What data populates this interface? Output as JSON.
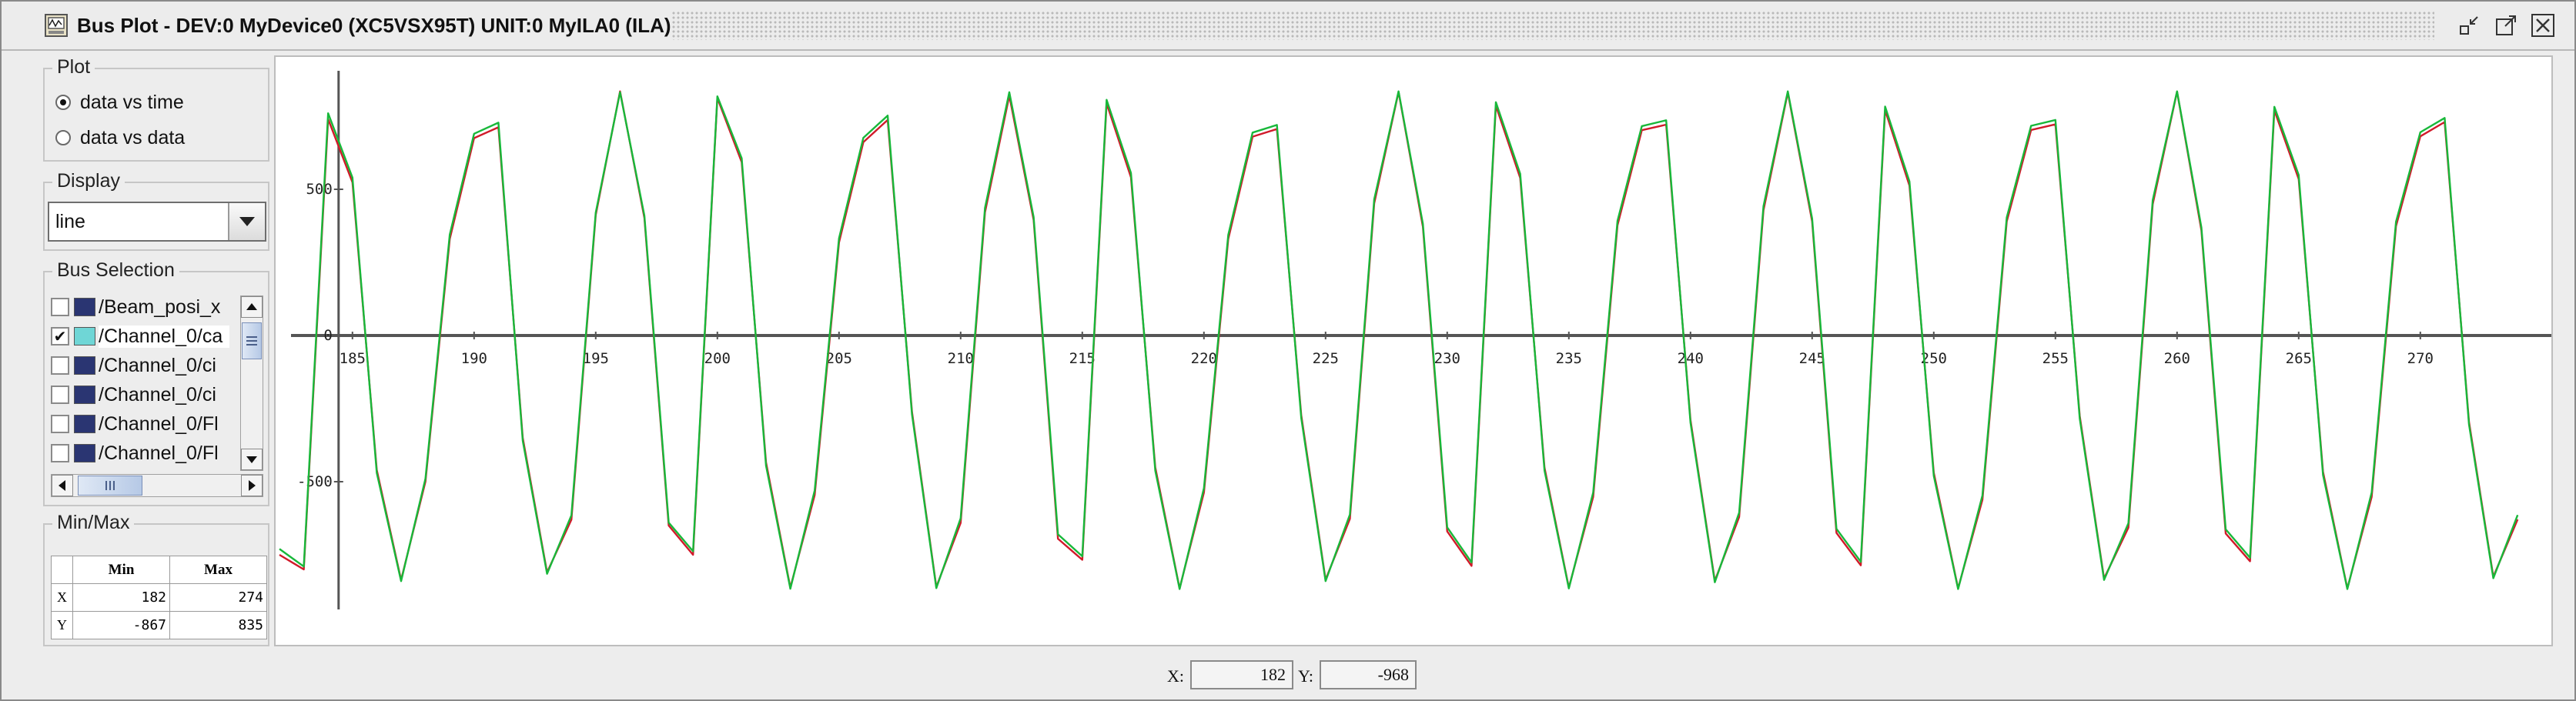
{
  "window": {
    "title": "Bus Plot - DEV:0 MyDevice0 (XC5VSX95T) UNIT:0 MyILA0 (ILA)",
    "buttons": [
      "restore-icon",
      "maximize-icon",
      "close-icon"
    ]
  },
  "plot_group": {
    "title": "Plot",
    "options": [
      {
        "label": "data vs time",
        "selected": true
      },
      {
        "label": "data vs data",
        "selected": false
      }
    ]
  },
  "display_group": {
    "title": "Display",
    "value": "line"
  },
  "bus_group": {
    "title": "Bus Selection",
    "items": [
      {
        "label": "/Beam_posi_x",
        "checked": false,
        "color": "#2a3572"
      },
      {
        "label": "/Channel_0/ca",
        "checked": true,
        "color": "#6fd6d6"
      },
      {
        "label": "/Channel_0/ci",
        "checked": false,
        "color": "#2a3572"
      },
      {
        "label": "/Channel_0/ci",
        "checked": false,
        "color": "#2a3572"
      },
      {
        "label": "/Channel_0/Fl",
        "checked": false,
        "color": "#2a3572"
      },
      {
        "label": "/Channel_0/Fl",
        "checked": false,
        "color": "#2a3572"
      }
    ]
  },
  "minmax_group": {
    "title": "Min/Max",
    "headers": [
      "Min",
      "Max"
    ],
    "rows": [
      {
        "label": "X",
        "min": "182",
        "max": "274"
      },
      {
        "label": "Y",
        "min": "-867",
        "max": "835"
      }
    ]
  },
  "chart_data": {
    "type": "line",
    "x_ticks": [
      "185",
      "190",
      "195",
      "200",
      "205",
      "210",
      "215",
      "220",
      "225",
      "230",
      "235",
      "240",
      "245",
      "250",
      "255",
      "260",
      "265",
      "270"
    ],
    "y_ticks": [
      "500",
      "0",
      "-500"
    ],
    "xlim": [
      182,
      274
    ],
    "ylim": [
      -867,
      835
    ],
    "grid": false,
    "series": [
      {
        "color": "#d11a2a",
        "x": [
          182,
          183,
          184,
          185,
          186,
          187,
          188,
          189,
          190,
          191,
          192,
          193,
          194,
          195,
          196,
          197,
          198,
          199,
          200,
          201,
          202,
          203,
          204,
          205,
          206,
          207,
          208,
          209,
          210,
          211,
          212,
          213,
          214,
          215,
          216,
          217,
          218,
          219,
          220,
          221,
          222,
          223,
          224,
          225,
          226,
          227,
          228,
          229,
          230,
          231,
          232,
          233,
          234,
          235,
          236,
          237,
          238,
          239,
          240,
          241,
          242,
          243,
          244,
          245,
          246,
          247,
          248,
          249,
          250,
          251,
          252,
          253,
          254,
          255,
          256,
          257,
          258,
          259,
          260,
          261,
          262,
          263,
          264,
          265,
          266,
          267,
          268,
          269,
          270,
          271,
          272,
          273,
          274
        ],
        "y": [
          -750,
          -800,
          740,
          524,
          -460,
          -836,
          -500,
          330,
          675,
          712,
          -350,
          -810,
          -630,
          412,
          835,
          402,
          -650,
          -750,
          812,
          593,
          -434,
          -862,
          -546,
          318,
          661,
          737,
          -261,
          -860,
          -641,
          421,
          820,
          395,
          -695,
          -767,
          794,
          541,
          -451,
          -865,
          -537,
          330,
          680,
          706,
          -272,
          -835,
          -627,
          452,
          833,
          372,
          -670,
          -788,
          786,
          539,
          -452,
          -862,
          -552,
          377,
          702,
          721,
          -289,
          -839,
          -621,
          428,
          831,
          390,
          -675,
          -786,
          771,
          513,
          -469,
          -865,
          -562,
          390,
          703,
          722,
          -275,
          -831,
          -657,
          449,
          834,
          360,
          -677,
          -772,
          770,
          535,
          -466,
          -865,
          -552,
          374,
          681,
          730,
          -295,
          -825,
          -629
        ]
      },
      {
        "color": "#18b83a",
        "x": [
          182,
          183,
          184,
          185,
          186,
          187,
          188,
          189,
          190,
          191,
          192,
          193,
          194,
          195,
          196,
          197,
          198,
          199,
          200,
          201,
          202,
          203,
          204,
          205,
          206,
          207,
          208,
          209,
          210,
          211,
          212,
          213,
          214,
          215,
          216,
          217,
          218,
          219,
          220,
          221,
          222,
          223,
          224,
          225,
          226,
          227,
          228,
          229,
          230,
          231,
          232,
          233,
          234,
          235,
          236,
          237,
          238,
          239,
          240,
          241,
          242,
          243,
          244,
          245,
          246,
          247,
          248,
          249,
          250,
          251,
          252,
          253,
          254,
          255,
          256,
          257,
          258,
          259,
          260,
          261,
          262,
          263,
          264,
          265,
          266,
          267,
          268,
          269,
          270,
          271,
          272,
          273,
          274
        ],
        "y": [
          -730,
          -790,
          760,
          540,
          -470,
          -840,
          -490,
          345,
          690,
          728,
          -360,
          -815,
          -615,
          420,
          832,
          410,
          -640,
          -738,
          818,
          606,
          -445,
          -866,
          -530,
          332,
          676,
          752,
          -270,
          -864,
          -625,
          436,
          832,
          405,
          -680,
          -755,
          806,
          556,
          -462,
          -867,
          -522,
          344,
          694,
          720,
          -282,
          -840,
          -612,
          466,
          835,
          382,
          -656,
          -776,
          798,
          553,
          -462,
          -865,
          -537,
          392,
          716,
          736,
          -298,
          -844,
          -606,
          442,
          835,
          400,
          -661,
          -774,
          783,
          527,
          -480,
          -867,
          -547,
          404,
          717,
          737,
          -284,
          -836,
          -642,
          463,
          835,
          370,
          -663,
          -760,
          782,
          549,
          -477,
          -867,
          -537,
          389,
          695,
          744,
          -304,
          -830,
          -614
        ]
      }
    ]
  },
  "status": {
    "x_label": "X:",
    "x_value": "182",
    "y_label": "Y:",
    "y_value": "-968"
  }
}
